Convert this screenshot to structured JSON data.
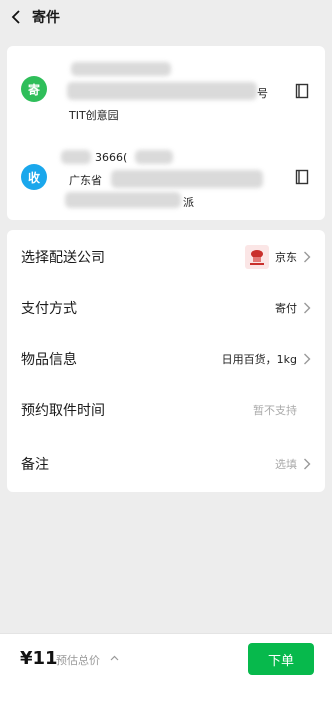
{
  "header": {
    "title": "寄件"
  },
  "sender": {
    "badge": "寄",
    "line1_suffix": "号",
    "line2": "TIT创意园"
  },
  "receiver": {
    "badge": "收",
    "phone_partial": "3666(",
    "line2_prefix": "广东省",
    "line3_suffix": "派"
  },
  "options": {
    "courier": {
      "label": "选择配送公司",
      "value": "京东"
    },
    "payment": {
      "label": "支付方式",
      "value": "寄付"
    },
    "item": {
      "label": "物品信息",
      "value": "日用百货，1kg"
    },
    "pickup": {
      "label": "预约取件时间",
      "value": "暂不支持"
    },
    "note": {
      "label": "备注",
      "value": "选填"
    }
  },
  "footer": {
    "price": "¥11",
    "price_label": "预估总价",
    "submit": "下单"
  },
  "colors": {
    "sender_badge": "#2fbe5a",
    "receiver_badge": "#1aa7ec",
    "submit": "#07b94c"
  }
}
